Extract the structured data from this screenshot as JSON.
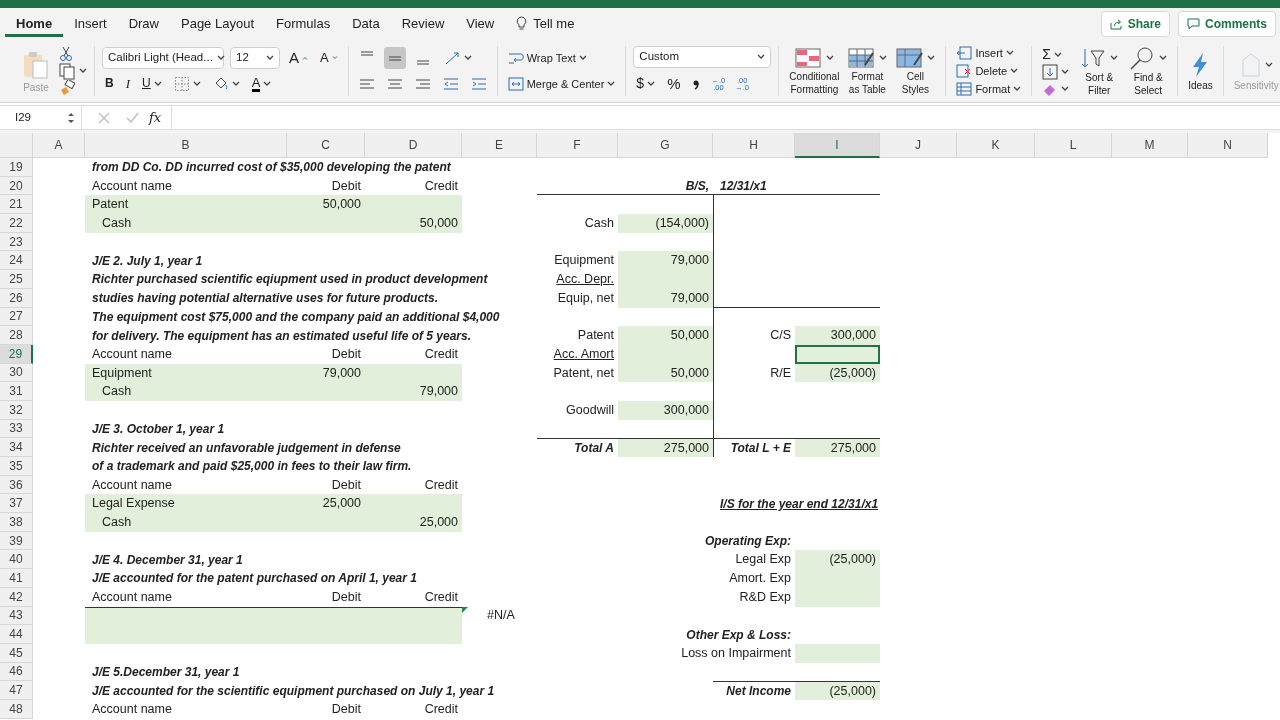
{
  "tabs": [
    {
      "label": "Home",
      "selected": true
    },
    {
      "label": "Insert",
      "selected": false
    },
    {
      "label": "Draw",
      "selected": false
    },
    {
      "label": "Page Layout",
      "selected": false
    },
    {
      "label": "Formulas",
      "selected": false
    },
    {
      "label": "Data",
      "selected": false
    },
    {
      "label": "Review",
      "selected": false
    },
    {
      "label": "View",
      "selected": false
    },
    {
      "label": "Tell me",
      "selected": false,
      "kind": "search"
    }
  ],
  "share": "Share",
  "comments": "Comments",
  "ribbon": {
    "paste": {
      "label": "Paste",
      "disabled": true
    },
    "font_name": "Calibri Light (Head...",
    "font_size": "12",
    "grow_font": "A",
    "shrink_font": "A",
    "bold": "B",
    "italic": "I",
    "underline": "U",
    "font_color": "A",
    "vertical_align": [
      {
        "selected": false
      },
      {
        "selected": true
      },
      {
        "selected": false
      }
    ],
    "wrap_text": "Wrap Text",
    "merge": "Merge & Center",
    "number_format": "Custom",
    "currency": "$",
    "percent": "%",
    "decimal_buttons": [
      {
        "top": "←.0",
        "bottom": ".00"
      },
      {
        "top": ".00",
        "bottom": "→.0"
      }
    ],
    "styles": [
      {
        "lines": [
          "Conditional",
          "Formatting"
        ],
        "kind": "conditional"
      },
      {
        "lines": [
          "Format",
          "as Table"
        ],
        "kind": "table"
      },
      {
        "lines": [
          "Cell",
          "Styles"
        ],
        "kind": "cell"
      }
    ],
    "cells_buttons": [
      {
        "label": "Insert",
        "kind": "insert"
      },
      {
        "label": "Delete",
        "kind": "delete"
      },
      {
        "label": "Format",
        "kind": "format"
      }
    ],
    "sum": "Σ",
    "sort": [
      "Sort &",
      "Filter"
    ],
    "find": [
      "Find &",
      "Select"
    ],
    "ideas": "Ideas",
    "sensitivity": {
      "label": "Sensitivity",
      "disabled": true
    }
  },
  "name_box": "I29",
  "fx": "fx",
  "columns": [
    {
      "label": "A",
      "selected": false
    },
    {
      "label": "B",
      "selected": false
    },
    {
      "label": "C",
      "selected": false
    },
    {
      "label": "D",
      "selected": false
    },
    {
      "label": "E",
      "selected": false
    },
    {
      "label": "F",
      "selected": false
    },
    {
      "label": "G",
      "selected": false
    },
    {
      "label": "H",
      "selected": false
    },
    {
      "label": "I",
      "selected": true
    },
    {
      "label": "J",
      "selected": false
    },
    {
      "label": "K",
      "selected": false
    },
    {
      "label": "L",
      "selected": false
    },
    {
      "label": "M",
      "selected": false
    },
    {
      "label": "N",
      "selected": false
    }
  ],
  "rows": [
    {
      "label": "19",
      "selected": false,
      "cells": [
        null,
        {
          "text": "from DD Co. DD incurred cost of $35,000 developing the patent",
          "kind": "note",
          "filled": false
        }
      ]
    },
    {
      "label": "20",
      "selected": false,
      "cells": [
        null,
        {
          "text": "Account name",
          "kind": "text",
          "filled": false
        },
        {
          "text": "Debit",
          "kind": "caption",
          "filled": false
        },
        {
          "text": "Credit",
          "kind": "caption",
          "filled": false
        },
        null,
        {
          "rule_bottom": true
        },
        {
          "text": "B/S,",
          "kind": "title",
          "filled": false,
          "rule_bottom": true
        },
        {
          "text": "12/31/x1",
          "kind": "note",
          "filled": false,
          "rule_bottom": true
        },
        {
          "rule_bottom": true
        }
      ]
    },
    {
      "label": "21",
      "selected": false,
      "cells": [
        null,
        {
          "text": "Patent",
          "kind": "text",
          "filled": true
        },
        {
          "text": "50,000",
          "kind": "number",
          "filled": true
        },
        {
          "filled": true
        },
        null,
        null,
        null,
        {
          "rule_left": true
        }
      ]
    },
    {
      "label": "22",
      "selected": false,
      "cells": [
        null,
        {
          "text": "Cash",
          "kind": "text",
          "indented": true,
          "filled": true
        },
        {
          "filled": true
        },
        {
          "text": "50,000",
          "kind": "number",
          "filled": true
        },
        null,
        {
          "text": "Cash",
          "kind": "caption",
          "filled": false
        },
        {
          "text": "(154,000)",
          "kind": "number",
          "filled": true
        },
        {
          "rule_left": true
        }
      ]
    },
    {
      "label": "23",
      "selected": false,
      "cells": [
        null,
        null,
        null,
        null,
        null,
        null,
        null,
        {
          "rule_left": true
        }
      ]
    },
    {
      "label": "24",
      "selected": false,
      "cells": [
        null,
        {
          "text": "J/E 2. July 1, year 1",
          "kind": "note",
          "filled": false
        },
        null,
        null,
        null,
        {
          "text": "Equipment",
          "kind": "caption",
          "filled": false
        },
        {
          "text": "79,000",
          "kind": "number",
          "filled": true
        },
        {
          "rule_left": true
        }
      ]
    },
    {
      "label": "25",
      "selected": false,
      "cells": [
        null,
        {
          "text": "Richter purchased scientific eqiupment used in product development",
          "kind": "note",
          "filled": false
        },
        null,
        null,
        null,
        {
          "text": "Acc. Depr.",
          "kind": "caption",
          "underlined": true,
          "filled": false
        },
        {
          "filled": true
        },
        {
          "rule_left": true
        }
      ]
    },
    {
      "label": "26",
      "selected": false,
      "cells": [
        null,
        {
          "text": "studies having potential alternative uses for future products.",
          "kind": "note",
          "filled": false
        },
        null,
        null,
        null,
        {
          "text": "Equip, net",
          "kind": "caption",
          "filled": false
        },
        {
          "text": "79,000",
          "kind": "number",
          "filled": true
        },
        {
          "rule_left": true,
          "rule_bottom": true
        },
        {
          "rule_bottom": true
        }
      ]
    },
    {
      "label": "27",
      "selected": false,
      "cells": [
        null,
        {
          "text": "The equipment cost $75,000 and the company paid an additional $4,000",
          "kind": "note",
          "filled": false
        },
        null,
        null,
        null,
        null,
        null,
        {
          "rule_left": true
        }
      ]
    },
    {
      "label": "28",
      "selected": false,
      "cells": [
        null,
        {
          "text": "for delivery. The equipment has an estimated useful life of 5 years.",
          "kind": "note",
          "filled": false
        },
        null,
        null,
        null,
        {
          "text": "Patent",
          "kind": "caption",
          "filled": false
        },
        {
          "text": "50,000",
          "kind": "number",
          "filled": true
        },
        {
          "text": "C/S",
          "kind": "caption",
          "filled": false,
          "rule_left": true
        },
        {
          "text": "300,000",
          "kind": "number",
          "filled": true
        }
      ]
    },
    {
      "label": "29",
      "selected": true,
      "cells": [
        null,
        {
          "text": "Account name",
          "kind": "text",
          "filled": false
        },
        {
          "text": "Debit",
          "kind": "caption",
          "filled": false
        },
        {
          "text": "Credit",
          "kind": "caption",
          "filled": false
        },
        null,
        {
          "text": "Acc. Amort",
          "kind": "caption",
          "underlined": true,
          "filled": false
        },
        {
          "filled": true
        },
        {
          "rule_left": true
        },
        {
          "filled": true
        }
      ]
    },
    {
      "label": "30",
      "selected": false,
      "cells": [
        null,
        {
          "text": "Equipment",
          "kind": "text",
          "filled": true
        },
        {
          "text": "79,000",
          "kind": "number",
          "filled": true
        },
        {
          "filled": true
        },
        null,
        {
          "text": "Patent, net",
          "kind": "caption",
          "filled": false
        },
        {
          "text": "50,000",
          "kind": "number",
          "filled": true
        },
        {
          "text": "R/E",
          "kind": "caption",
          "filled": false,
          "rule_left": true
        },
        {
          "text": "(25,000)",
          "kind": "number",
          "filled": true
        }
      ]
    },
    {
      "label": "31",
      "selected": false,
      "cells": [
        null,
        {
          "text": "Cash",
          "kind": "text",
          "indented": true,
          "filled": true
        },
        {
          "filled": true
        },
        {
          "text": "79,000",
          "kind": "number",
          "filled": true
        },
        null,
        null,
        null,
        {
          "rule_left": true
        }
      ]
    },
    {
      "label": "32",
      "selected": false,
      "cells": [
        null,
        null,
        null,
        null,
        null,
        {
          "text": "Goodwill",
          "kind": "caption",
          "filled": false
        },
        {
          "text": "300,000",
          "kind": "number",
          "filled": true
        },
        {
          "rule_left": true
        }
      ]
    },
    {
      "label": "33",
      "selected": false,
      "cells": [
        null,
        {
          "text": "J/E 3. October 1, year 1",
          "kind": "note",
          "filled": false
        },
        null,
        null,
        null,
        null,
        null,
        {
          "rule_left": true
        }
      ]
    },
    {
      "label": "34",
      "selected": false,
      "cells": [
        null,
        {
          "text": "Richter received an unfavorable judgement in defense",
          "kind": "note",
          "filled": false
        },
        null,
        null,
        null,
        {
          "text": "Total A",
          "kind": "title",
          "filled": false,
          "rule_top": true
        },
        {
          "text": "275,000",
          "kind": "number",
          "filled": true,
          "rule_top": true
        },
        {
          "text": "Total L + E",
          "kind": "title",
          "filled": false,
          "rule_top": true,
          "rule_left": true
        },
        {
          "text": "275,000",
          "kind": "number",
          "filled": true,
          "rule_top": true
        }
      ]
    },
    {
      "label": "35",
      "selected": false,
      "cells": [
        null,
        {
          "text": "of a trademark and paid $25,000 in fees to their law firm.",
          "kind": "note",
          "filled": false
        }
      ]
    },
    {
      "label": "36",
      "selected": false,
      "cells": [
        null,
        {
          "text": "Account name",
          "kind": "text",
          "filled": false
        },
        {
          "text": "Debit",
          "kind": "caption",
          "filled": false
        },
        {
          "text": "Credit",
          "kind": "caption",
          "filled": false
        }
      ]
    },
    {
      "label": "37",
      "selected": false,
      "cells": [
        null,
        {
          "text": "Legal Expense",
          "kind": "text",
          "filled": true
        },
        {
          "text": "25,000",
          "kind": "number",
          "filled": true
        },
        {
          "filled": true
        },
        null,
        null,
        null,
        {
          "text": "I/S for the year end 12/31/x1",
          "kind": "note",
          "underlined": true,
          "filled": false
        }
      ]
    },
    {
      "label": "38",
      "selected": false,
      "cells": [
        null,
        {
          "text": "Cash",
          "kind": "text",
          "indented": true,
          "filled": true
        },
        {
          "filled": true
        },
        {
          "text": "25,000",
          "kind": "number",
          "filled": true
        }
      ]
    },
    {
      "label": "39",
      "selected": false,
      "cells": [
        null,
        null,
        null,
        null,
        null,
        null,
        null,
        {
          "text": "Operating Exp:",
          "kind": "title",
          "filled": false
        }
      ]
    },
    {
      "label": "40",
      "selected": false,
      "cells": [
        null,
        {
          "text": "J/E 4. December 31, year 1",
          "kind": "note",
          "filled": false
        },
        null,
        null,
        null,
        null,
        null,
        {
          "text": "Legal Exp",
          "kind": "caption",
          "filled": false
        },
        {
          "text": "(25,000)",
          "kind": "number",
          "filled": true
        }
      ]
    },
    {
      "label": "41",
      "selected": false,
      "cells": [
        null,
        {
          "text": "J/E accounted for the patent purchased on April 1, year 1",
          "kind": "note",
          "filled": false
        },
        null,
        null,
        null,
        null,
        null,
        {
          "text": "Amort. Exp",
          "kind": "caption",
          "filled": false
        },
        {
          "filled": true
        }
      ]
    },
    {
      "label": "42",
      "selected": false,
      "cells": [
        null,
        {
          "text": "Account name",
          "kind": "text",
          "filled": false
        },
        {
          "text": "Debit",
          "kind": "caption",
          "filled": false
        },
        {
          "text": "Credit",
          "kind": "caption",
          "filled": false
        },
        null,
        null,
        null,
        {
          "text": "R&D Exp",
          "kind": "caption",
          "filled": false
        },
        {
          "filled": true
        }
      ]
    },
    {
      "label": "43",
      "selected": false,
      "cells": [
        null,
        {
          "filled": true,
          "rule_top": true
        },
        {
          "filled": true,
          "rule_top": true
        },
        {
          "filled": true,
          "rule_top": true
        },
        {
          "text": "#N/A",
          "kind": "error",
          "filled": false
        }
      ]
    },
    {
      "label": "44",
      "selected": false,
      "cells": [
        null,
        {
          "filled": true
        },
        {
          "filled": true
        },
        {
          "filled": true
        },
        null,
        null,
        null,
        {
          "text": "Other Exp & Loss:",
          "kind": "title",
          "filled": false
        }
      ]
    },
    {
      "label": "45",
      "selected": false,
      "cells": [
        null,
        null,
        null,
        null,
        null,
        null,
        null,
        {
          "text": "Loss on Impairment",
          "kind": "caption",
          "filled": false
        },
        {
          "filled": true
        }
      ]
    },
    {
      "label": "46",
      "selected": false,
      "cells": [
        null,
        {
          "text": "J/E 5.December 31, year 1",
          "kind": "note",
          "filled": false
        }
      ]
    },
    {
      "label": "47",
      "selected": false,
      "cells": [
        null,
        {
          "text": "J/E accounted for the scientific equipment purchased on July 1, year 1",
          "kind": "note",
          "filled": false
        },
        null,
        null,
        null,
        null,
        null,
        {
          "text": "Net Income",
          "kind": "title",
          "filled": false,
          "rule_top": true
        },
        {
          "text": "(25,000)",
          "kind": "number",
          "filled": true,
          "rule_top": true
        }
      ]
    },
    {
      "label": "48",
      "selected": false,
      "cells": [
        null,
        {
          "text": "Account name",
          "kind": "text",
          "filled": false
        },
        {
          "text": "Debit",
          "kind": "caption",
          "filled": false
        },
        {
          "text": "Credit",
          "kind": "caption",
          "filled": false
        }
      ]
    }
  ]
}
